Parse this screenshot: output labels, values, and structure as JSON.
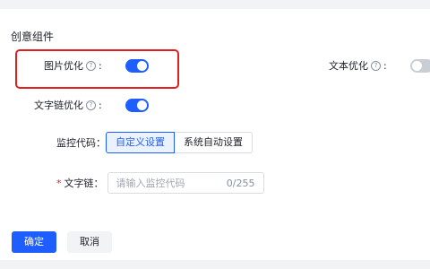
{
  "section": {
    "title": "创意组件"
  },
  "fields": {
    "image_opt": {
      "label": "图片优化",
      "colon": ":",
      "enabled": true
    },
    "text_opt": {
      "label": "文本优化",
      "colon": ":",
      "enabled": false
    },
    "text_link_opt": {
      "label": "文字链优化",
      "colon": ":",
      "enabled": true
    },
    "monitor_code": {
      "label": "监控代码：",
      "options": [
        "自定义设置",
        "系统自动设置"
      ],
      "selected": "自定义设置"
    },
    "text_link": {
      "required_mark": "*",
      "label": "文字链：",
      "placeholder": "请输入监控代码",
      "counter": "0/255"
    }
  },
  "actions": {
    "confirm_label": "确定",
    "cancel_label": "取消"
  },
  "icons": {
    "help": "question-circle-icon"
  },
  "colors": {
    "primary": "#1e5eff",
    "highlight": "#e0201e",
    "toggle_off": "#c9cdd4"
  }
}
